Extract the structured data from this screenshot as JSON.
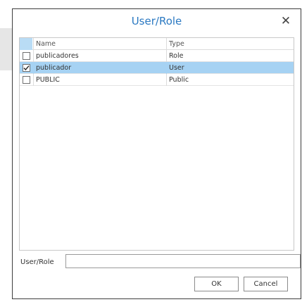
{
  "dialog": {
    "title": "User/Role",
    "close_glyph": "✕"
  },
  "grid": {
    "columns": {
      "name": "Name",
      "type": "Type"
    },
    "rows": [
      {
        "name": "publicadores",
        "type": "Role",
        "checked": false,
        "selected": false
      },
      {
        "name": "publicador",
        "type": "User",
        "checked": true,
        "selected": true
      },
      {
        "name": "PUBLIC",
        "type": "Public",
        "checked": false,
        "selected": false
      }
    ]
  },
  "form": {
    "label": "User/Role",
    "value": ""
  },
  "buttons": {
    "ok": "OK",
    "cancel": "Cancel"
  },
  "colors": {
    "title": "#2b79c2",
    "selected_row": "#a6d2f3",
    "header_check_cell": "#b9dcf5"
  },
  "icons": {
    "close": "close-icon",
    "check": "checkmark-icon"
  }
}
